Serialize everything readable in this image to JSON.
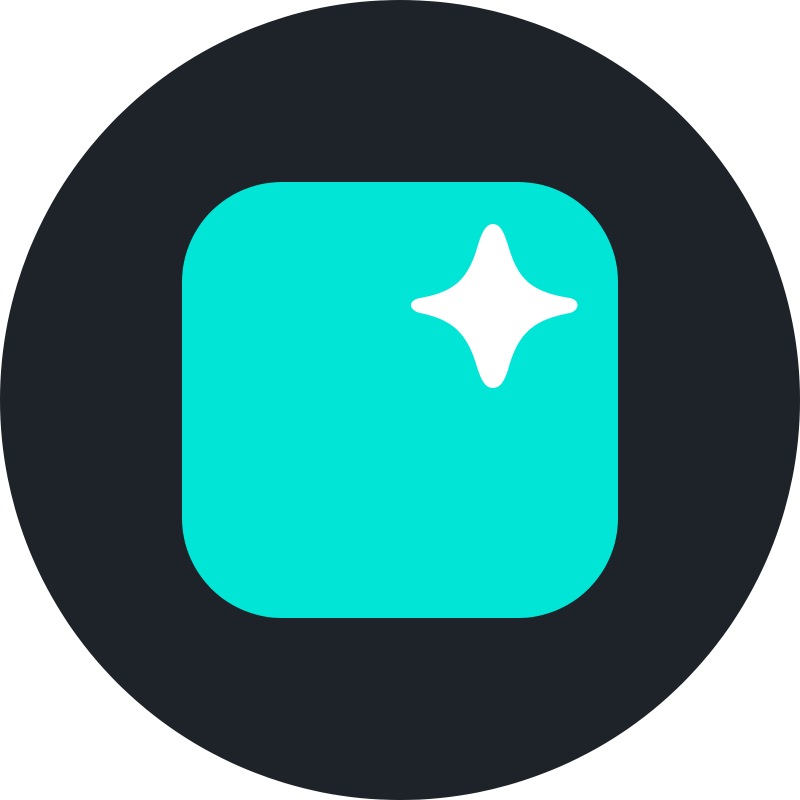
{
  "logo": {
    "icon": "sparkle-in-rounded-square",
    "colors": {
      "background_circle": "#1e2229",
      "tile": "#00e5d6",
      "sparkle": "#ffffff"
    }
  }
}
